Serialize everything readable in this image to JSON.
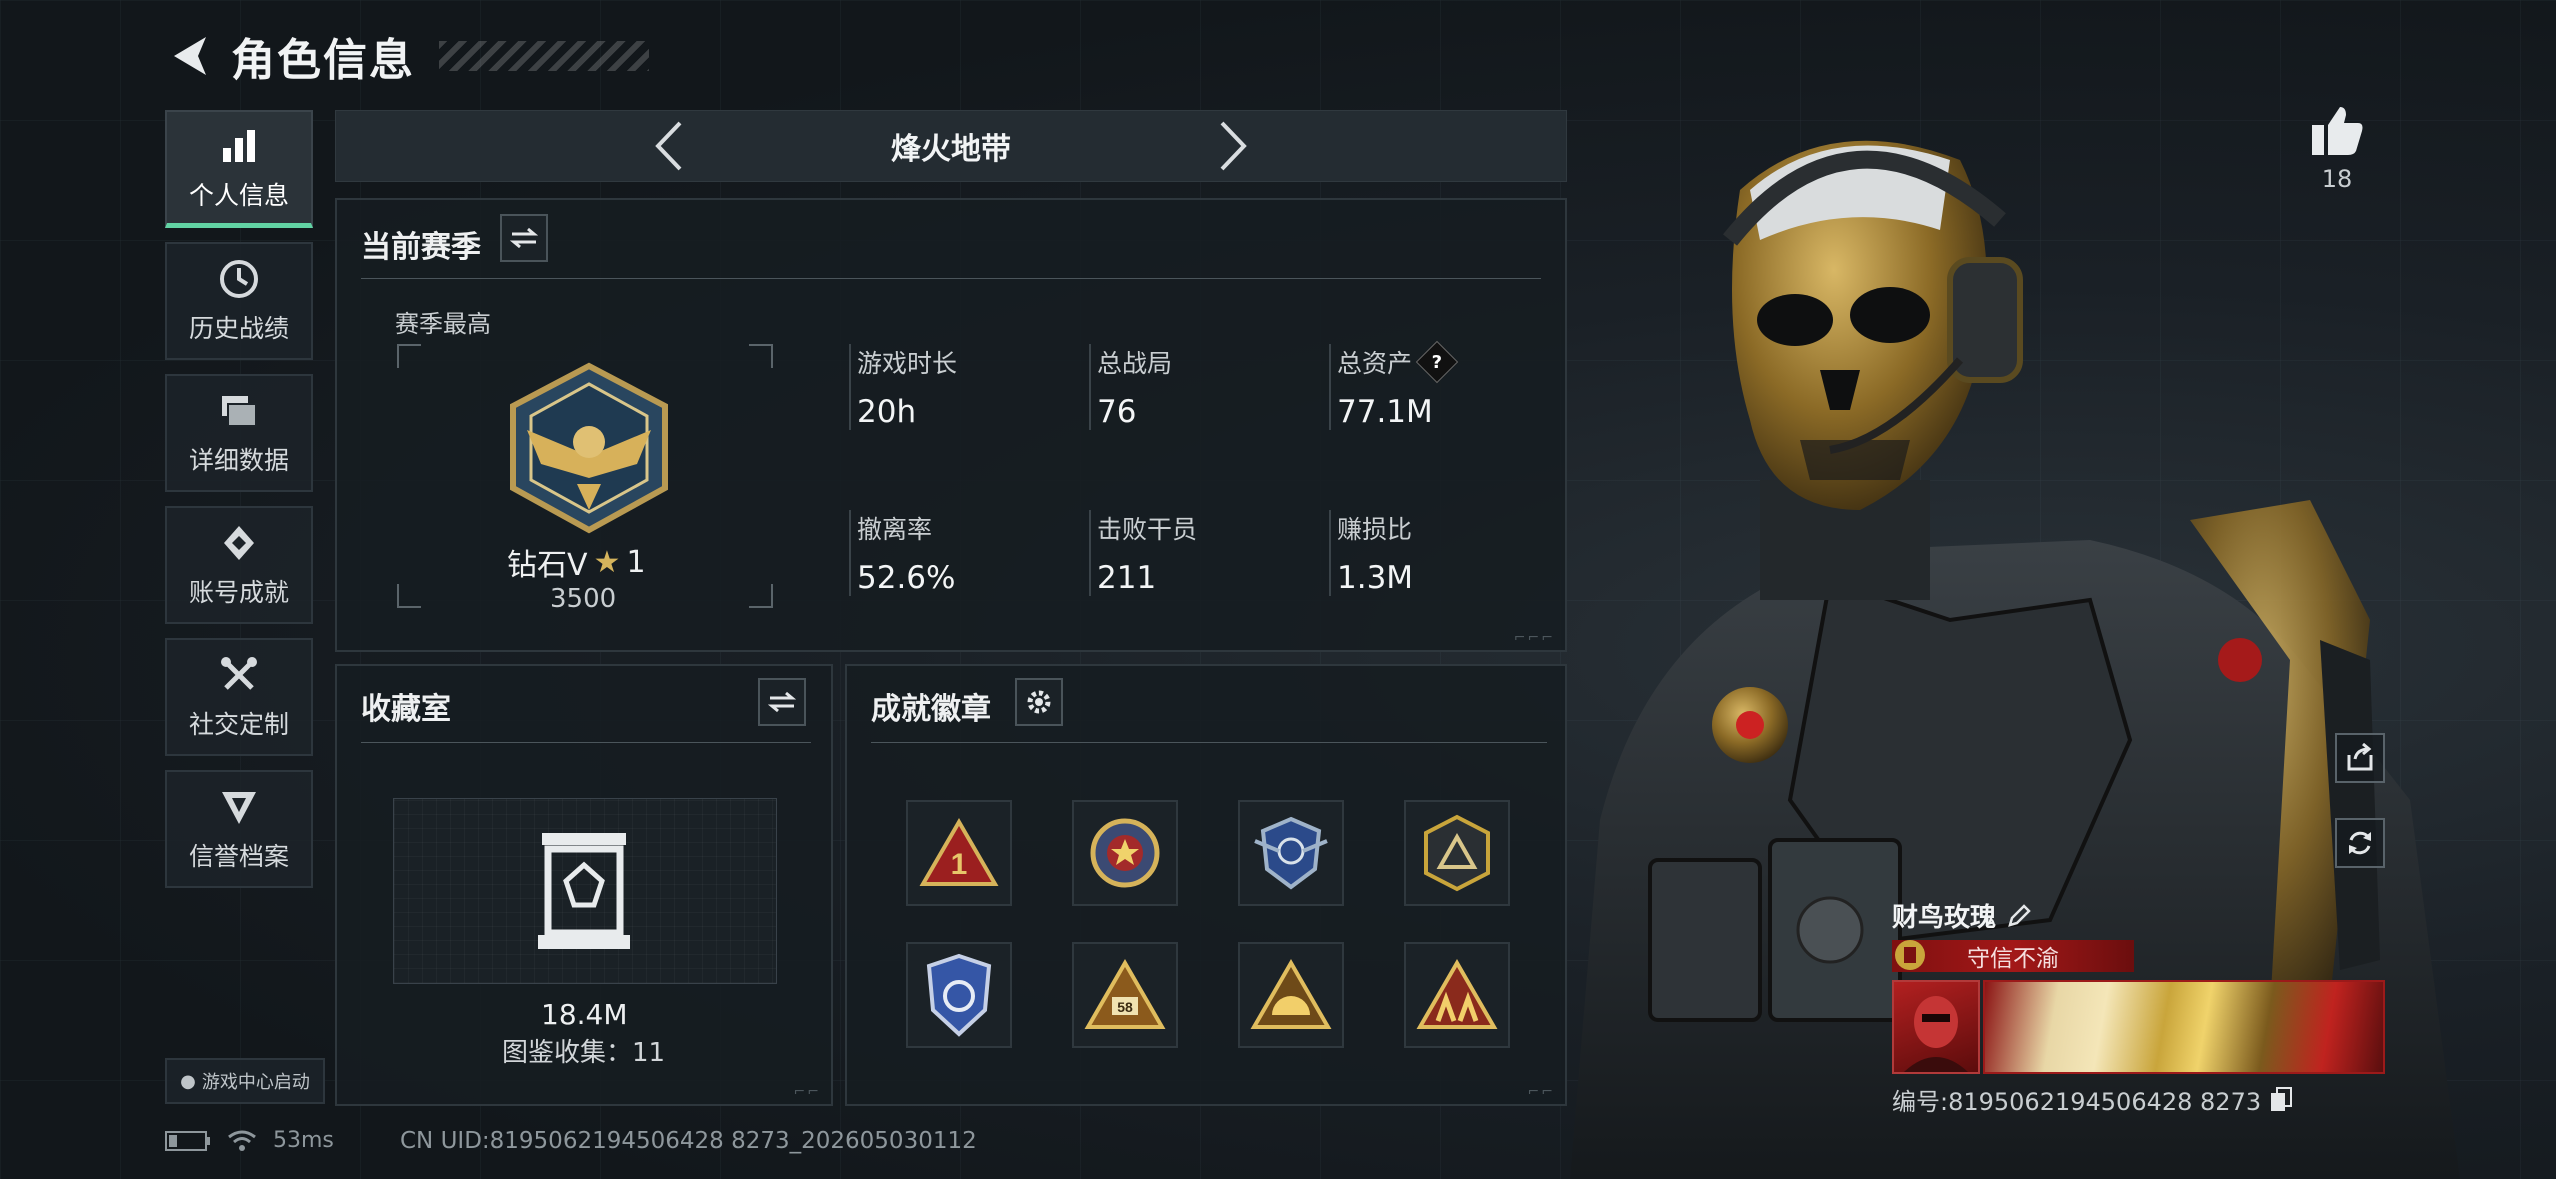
{
  "header": {
    "title": "角色信息"
  },
  "sidebar": {
    "items": [
      {
        "label": "个人信息",
        "icon": "bar-chart-icon",
        "active": true
      },
      {
        "label": "历史战绩",
        "icon": "history-icon"
      },
      {
        "label": "详细数据",
        "icon": "folders-icon"
      },
      {
        "label": "账号成就",
        "icon": "achievement-icon"
      },
      {
        "label": "社交定制",
        "icon": "tools-icon"
      },
      {
        "label": "信誉档案",
        "icon": "credit-icon"
      }
    ],
    "game_center": "游戏中心启动"
  },
  "map_selector": {
    "name": "烽火地带"
  },
  "season": {
    "title": "当前赛季",
    "best_label": "赛季最高",
    "rank": "钻石V",
    "stars": "1",
    "score": "3500",
    "stats": [
      {
        "label": "游戏时长",
        "value": "20h"
      },
      {
        "label": "总战局",
        "value": "76"
      },
      {
        "label": "总资产",
        "value": "77.1M",
        "help": "?"
      },
      {
        "label": "撤离率",
        "value": "52.6%"
      },
      {
        "label": "击败干员",
        "value": "211"
      },
      {
        "label": "赚损比",
        "value": "1.3M"
      }
    ]
  },
  "collection": {
    "title": "收藏室",
    "value": "18.4M",
    "count_text": "图鉴收集：11"
  },
  "achievements": {
    "title": "成就徽章",
    "badges": [
      "rank-1-badge-icon",
      "star-medal-badge-icon",
      "winged-shield-badge-icon",
      "triangle-badge-icon",
      "blue-shield-badge-icon",
      "level-58-badge-icon",
      "sunrise-triangle-badge-icon",
      "team-triangle-badge-icon"
    ],
    "badge_58_text": "58"
  },
  "status_bar": {
    "ping": "53ms",
    "uid": "CN UID:8195062194506428 8273_202605030112"
  },
  "player": {
    "likes": "18",
    "name": "财鸟玫瑰",
    "title": "守信不渝",
    "id_text": "编号:8195062194506428 8273"
  },
  "colors": {
    "accent": "#62d3a4",
    "ribbon": "#a31818",
    "gold": "#c9a53b"
  }
}
